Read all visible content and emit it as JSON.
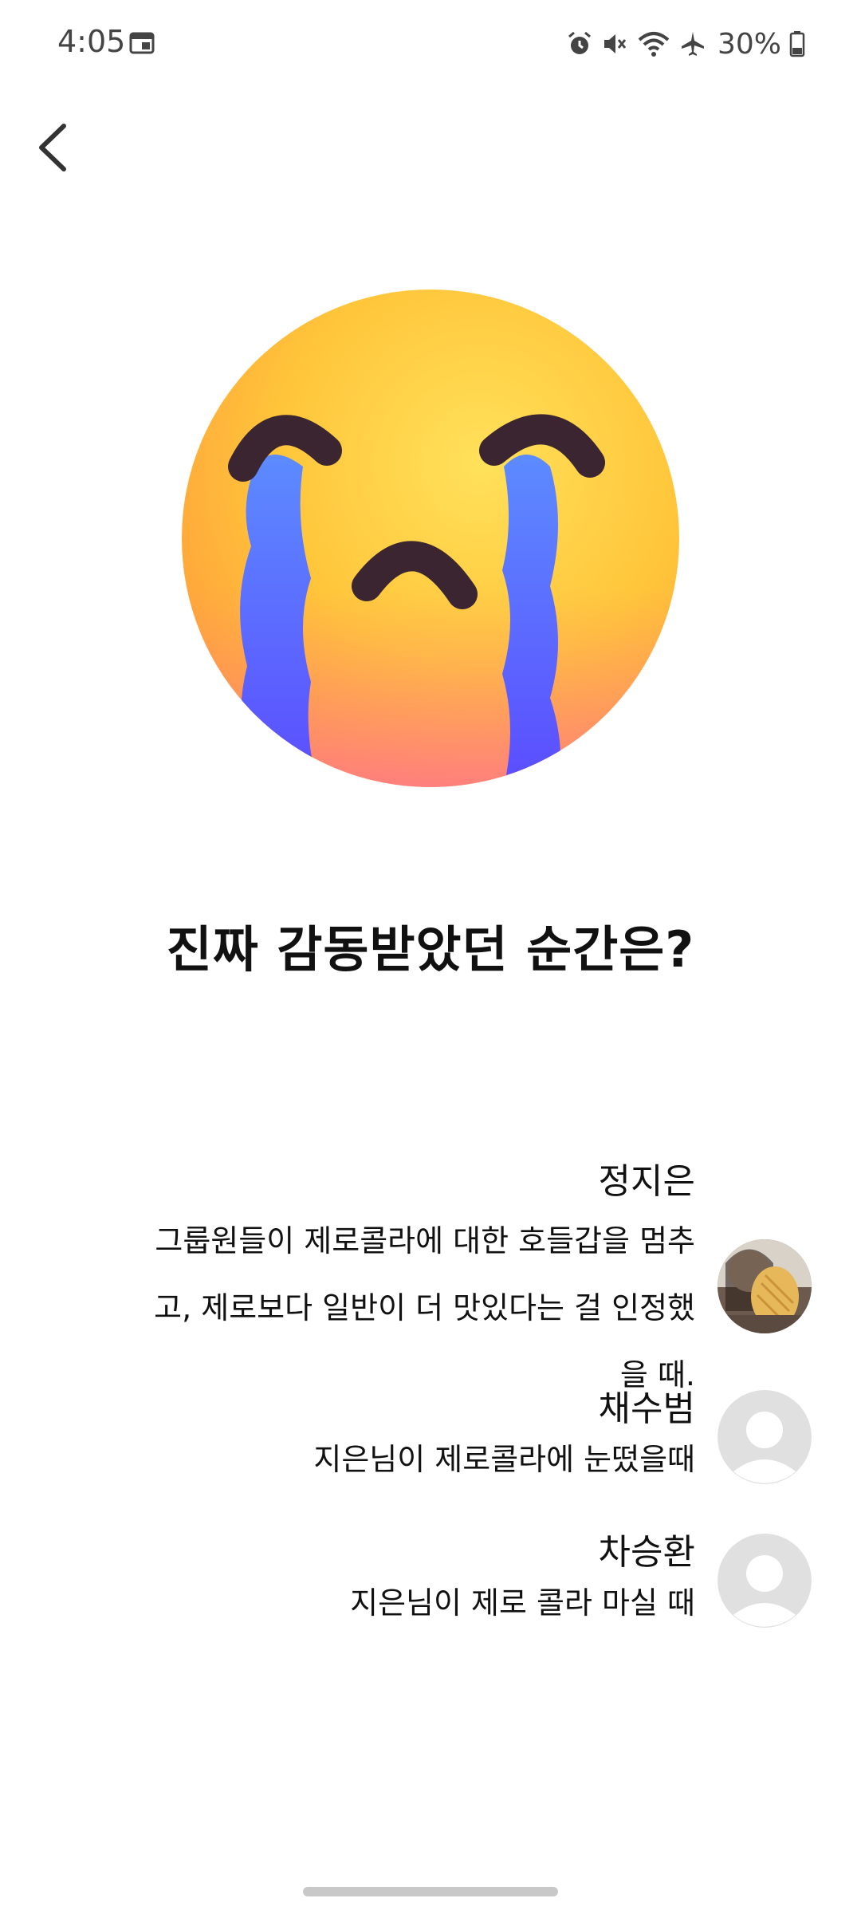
{
  "status": {
    "time": "4:05",
    "battery": "30%",
    "icons": [
      "calendar-icon",
      "alarm-icon",
      "mute-icon",
      "wifi-icon",
      "airplane-icon",
      "battery-icon"
    ]
  },
  "nav": {
    "back_icon": "chevron-left-icon"
  },
  "hero": {
    "emoji": "crying-face-icon"
  },
  "question": "진짜 감동받았던 순간은?",
  "answers": [
    {
      "name": "정지은",
      "text": "그룹원들이 제로콜라에 대한 호들갑을 멈추고, 제로보다 일반이 더 맛있다는 걸 인정했을 때.",
      "avatar": "photo"
    },
    {
      "name": "채수범",
      "text": "지은님이 제로콜라에 눈떴을때",
      "avatar": "default"
    },
    {
      "name": "차승환",
      "text": "지은님이 제로 콜라 마실 때",
      "avatar": "default"
    }
  ],
  "colors": {
    "face": "#FFC83D",
    "tears": "#4F6BFF",
    "features": "#3A2530",
    "avatar_placeholder": "#E0E0E0"
  }
}
